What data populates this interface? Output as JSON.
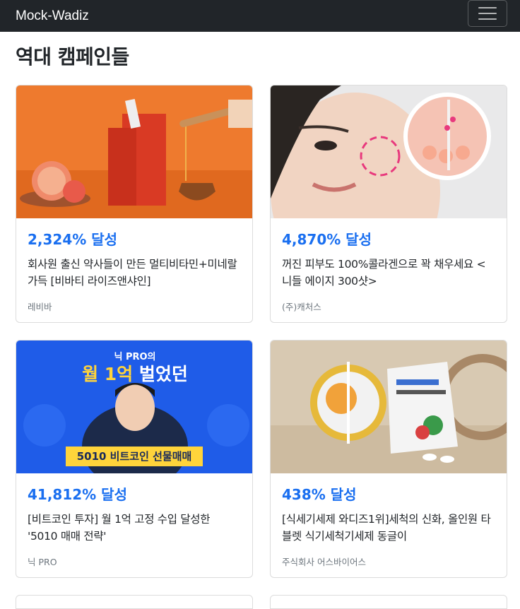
{
  "navbar": {
    "brand": "Mock-Wadiz",
    "menu_icon": "hamburger-icon"
  },
  "page": {
    "title": "역대 캠페인들"
  },
  "campaigns": [
    {
      "rate": "2,324% 달성",
      "title": "회사원 출신 약사들이 만든 멀티비타민+미네랄 가득 [비바티 라이즈앤샤인]",
      "maker": "레비바",
      "image": "vitamin-product-photo"
    },
    {
      "rate": "4,870% 달성",
      "title": "꺼진 피부도 100%콜라겐으로 꽉 채우세요 <니들 에이지 300샷>",
      "maker": "(주)캐처스",
      "image": "skincare-model-photo"
    },
    {
      "rate": "41,812% 달성",
      "title": "[비트코인 투자] 월 1억 고정 수입 달성한 '5010 매매 전략'",
      "maker": "닉 PRO",
      "image": "bitcoin-course-banner",
      "banner": {
        "line1": "닉 PRO의",
        "line2a": "월 1억",
        "line2b": " 벌었던",
        "tag": "5010 비트코인 선물매매"
      }
    },
    {
      "rate": "438% 달성",
      "title": "[식세기세제 와디즈1위]세척의 신화, 올인원 타블렛 식기세척기세제 동글이",
      "maker": "주식회사 어스바이어스",
      "image": "dishwasher-tablet-photo"
    }
  ],
  "colors": {
    "accent": "#1a6ff0",
    "navbar": "#212529"
  }
}
